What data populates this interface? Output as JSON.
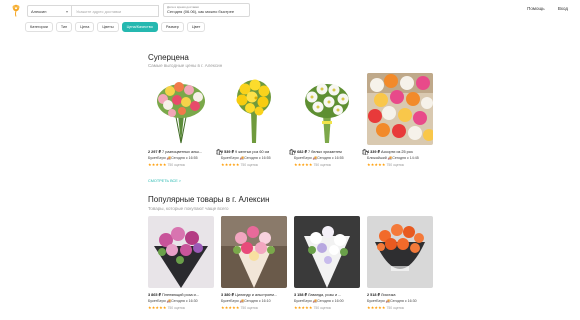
{
  "header": {
    "city": "Алексин",
    "address_placeholder": "Укажите адрес доставки",
    "delivery_label": "Дата и время доставки",
    "delivery_value": "Сегодня (06.06), как можно быстрее",
    "help": "Помощь",
    "login": "Вход"
  },
  "filters": [
    "Категории",
    "Тип",
    "Цена",
    "Цветы",
    "Цена/Качество",
    "Размер",
    "Цвет"
  ],
  "active_filter": "Цена/Качество",
  "section1": {
    "title": "Суперцена",
    "subtitle": "Самые выгодные цены в г. Алексин",
    "see_all": "СМОТРЕТЬ ВСЕ >",
    "cards": [
      {
        "price": "2 297 ₽",
        "name": "7 разноцветных альс...",
        "shop": "БукетБери",
        "eta": "Сегодня с 16:55",
        "reviews": "750 оценок"
      },
      {
        "price": "2 539 ₽",
        "name": "9 желтых роз 60 см",
        "shop": "БукетБери",
        "eta": "Сегодня с 16:55",
        "reviews": "750 оценок"
      },
      {
        "price": "2 682 ₽",
        "name": "7 белых хризантем",
        "shop": "БукетБери",
        "eta": "Сегодня с 16:55",
        "reviews": "750 оценок"
      },
      {
        "price": "4 339 ₽",
        "name": "Ассорти из 25 роз",
        "shop": "Ближайший",
        "eta": "Сегодня с 14:45",
        "reviews": "750 оценок"
      }
    ]
  },
  "section2": {
    "title": "Популярные товары в г. Алексин",
    "subtitle": "Товары, которые покупают чаще всего",
    "cards": [
      {
        "price": "3 865 ₽",
        "name": "Пленяющий роза и...",
        "shop": "БукетБери",
        "eta": "Сегодня с 16:30",
        "reviews": "750 оценок"
      },
      {
        "price": "3 380 ₽",
        "name": "Цилиндр и альстроем...",
        "shop": "БукетБери",
        "eta": "Сегодня с 16:10",
        "reviews": "750 оценок"
      },
      {
        "price": "3 158 ₽",
        "name": "Лаванда, розы и ...",
        "shop": "БукетБери",
        "eta": "Сегодня с 16:00",
        "reviews": "750 оценок"
      },
      {
        "price": "2 518 ₽",
        "name": "Лисичка",
        "shop": "БукетБери",
        "eta": "Сегодня с 16:30",
        "reviews": "750 оценок"
      }
    ]
  },
  "icons": {
    "logo": "flower-logo-icon",
    "bag": "shopping-bag-icon",
    "star": "star-icon",
    "truck": "delivery-icon"
  },
  "colors": {
    "accent": "#25b8b0",
    "stars": "#ff9b00",
    "logo": "#f5a623"
  }
}
